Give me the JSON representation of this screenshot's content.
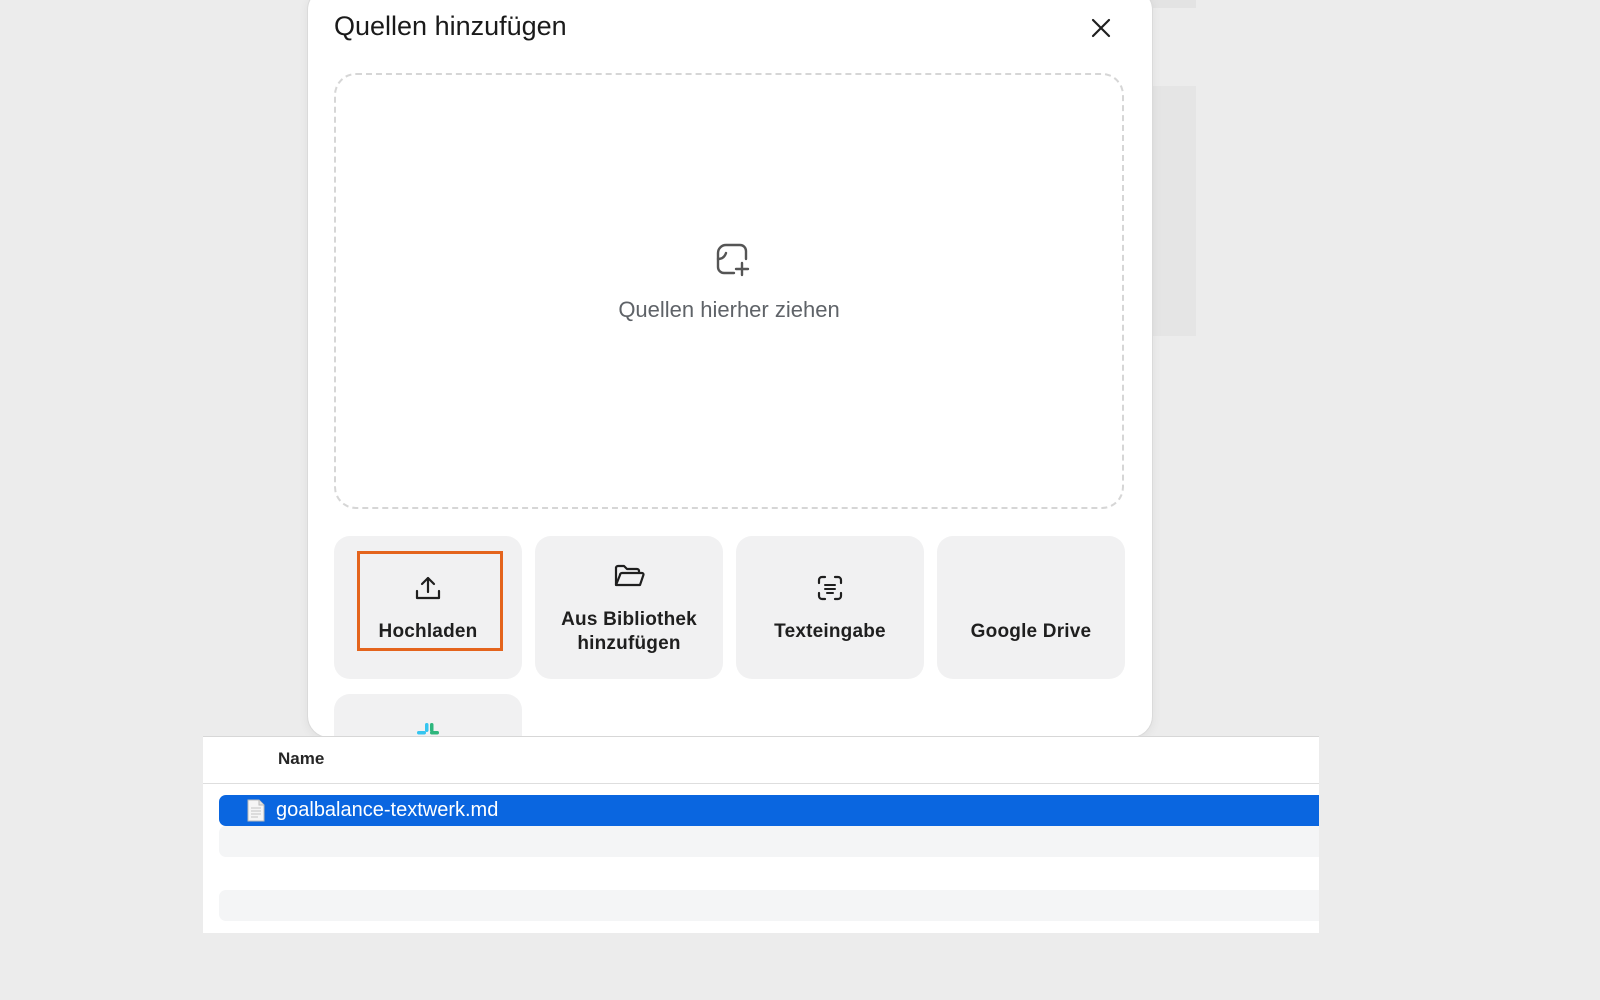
{
  "dialog": {
    "title": "Quellen hinzufügen",
    "close_icon": "close-icon",
    "dropzone": {
      "icon": "add-source-icon",
      "text": "Quellen hierher ziehen"
    },
    "tiles": [
      {
        "id": "upload",
        "icon": "upload-icon",
        "label": "Hochladen",
        "highlighted": true
      },
      {
        "id": "library",
        "icon": "folder-open-icon",
        "label_line1": "Aus Bibliothek",
        "label_line2": "hinzufügen"
      },
      {
        "id": "text",
        "icon": "text-scan-icon",
        "label": "Texteingabe"
      },
      {
        "id": "gdrive",
        "label": "Google Drive"
      },
      {
        "id": "slack",
        "icon": "slack-icon"
      }
    ]
  },
  "file_browser": {
    "column_header": "Name",
    "rows": [
      {
        "name": "goalbalance-textwerk.md",
        "icon": "document-icon",
        "selected": true
      }
    ]
  },
  "colors": {
    "highlight": "#e4641d",
    "selection": "#0a66e0",
    "tile_bg": "#f1f1f2"
  }
}
